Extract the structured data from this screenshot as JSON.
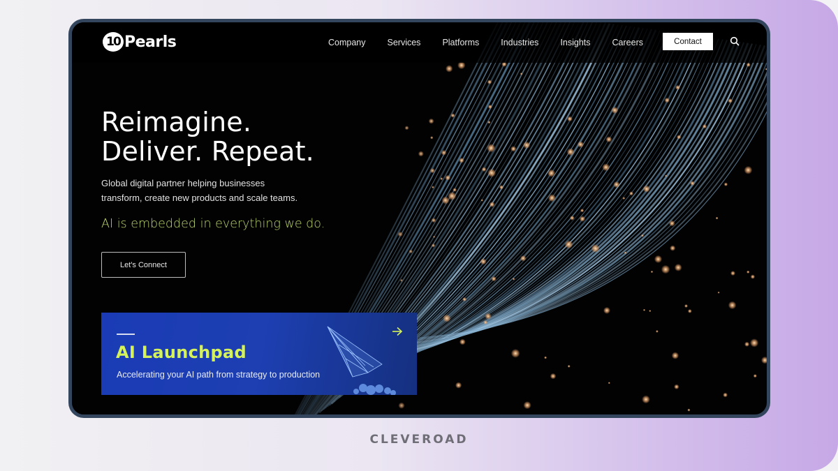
{
  "site": {
    "logo_mark": "10",
    "logo_text": "Pearls"
  },
  "nav": {
    "items": [
      {
        "label": "Company"
      },
      {
        "label": "Services"
      },
      {
        "label": "Platforms"
      },
      {
        "label": "Industries"
      },
      {
        "label": "Insights"
      },
      {
        "label": "Careers"
      }
    ],
    "contact_label": "Contact",
    "search_icon": "search-icon"
  },
  "hero": {
    "headline_line1": "Reimagine.",
    "headline_line2": "Deliver. Repeat.",
    "subtext_line1": "Global digital partner helping businesses",
    "subtext_line2": "transform, create new products and scale teams.",
    "ai_tagline": "AI is embedded in everything we do.",
    "cta_label": "Let's Connect"
  },
  "launchpad": {
    "title": "AI Launchpad",
    "subtitle": "Accelerating your AI path from strategy to production",
    "arrow_icon": "arrow-right-icon"
  },
  "colors": {
    "accent_green": "#b9d26a",
    "launchpad_title": "#d6f25a",
    "launchpad_bg": "#1a3bb5",
    "frame_border": "#34465e"
  },
  "watermark": "CLEVEROAD"
}
